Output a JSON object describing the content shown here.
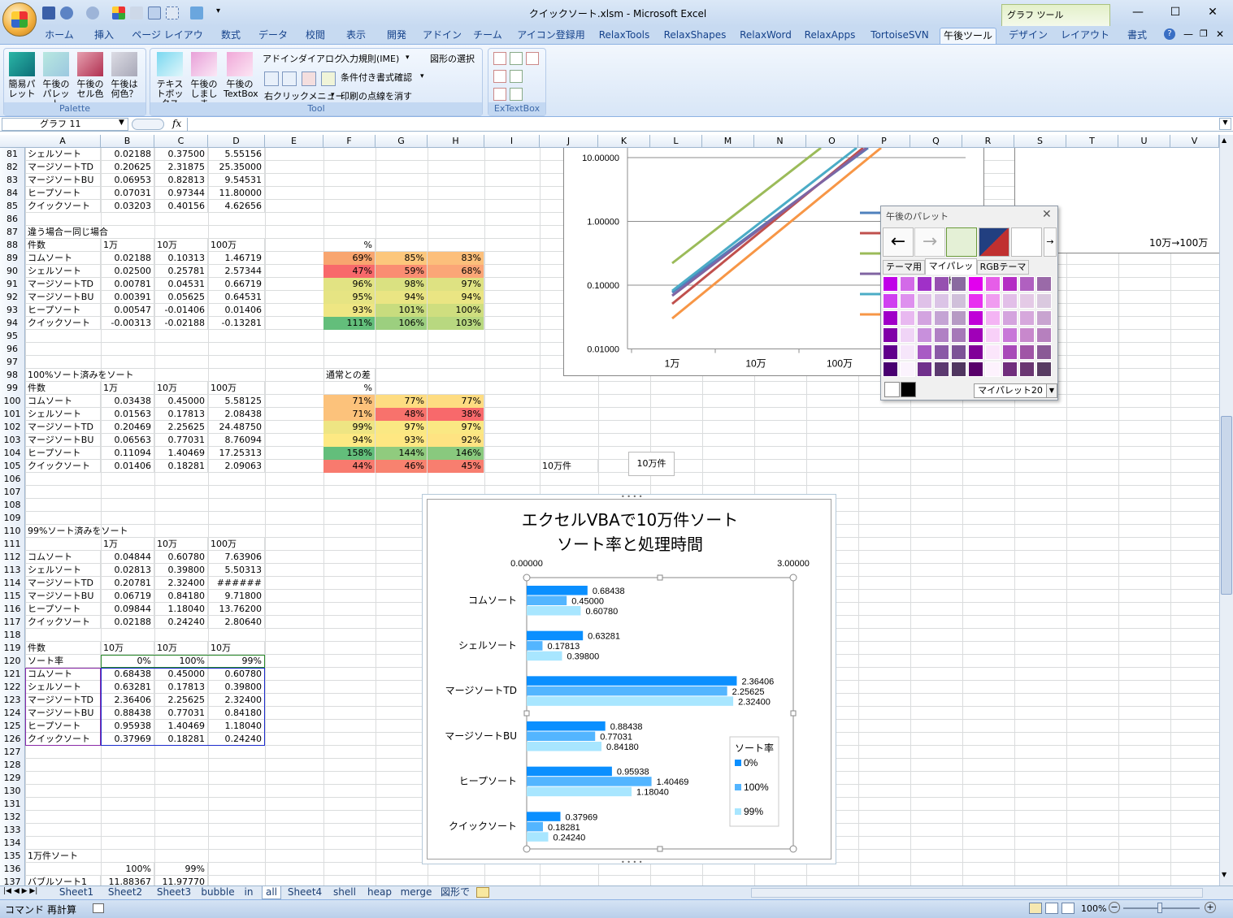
{
  "window": {
    "title": "クイックソート.xlsm - Microsoft Excel",
    "graph_tools": "グラフ ツール",
    "controls": [
      "—",
      "☐",
      "✕"
    ]
  },
  "tabs": [
    "ホーム",
    "挿入",
    "ページ レイアウト",
    "数式",
    "データ",
    "校閲",
    "表示",
    "開発",
    "アドイン",
    "チーム",
    "アイコン登録用",
    "RelaxTools",
    "RelaxShapes",
    "RelaxWord",
    "RelaxApps",
    "TortoiseSVN",
    "午後ツール",
    "デザイン",
    "レイアウト",
    "書式"
  ],
  "active_tab": "午後ツール",
  "ribbon": {
    "palette_group": {
      "label": "Palette",
      "buttons": [
        "簡易パレット",
        "午後のパレット",
        "午後のセル色",
        "午後は何色？"
      ]
    },
    "tool_group": {
      "label": "Tool",
      "big_buttons": [
        "テキストボックス",
        "午後のしましま",
        "午後のTextBox"
      ],
      "small": [
        "アドインダイアログ",
        "入力規則(IME)",
        "図形の選択",
        "条件付き書式確認",
        "右クリックメニュー",
        "印刷の点線を消す"
      ]
    },
    "extextbox_group": {
      "label": "ExTextBox"
    }
  },
  "formula_bar": {
    "name_box": "グラフ 11",
    "fx": "fx",
    "content": ""
  },
  "columns": [
    "A",
    "B",
    "C",
    "D",
    "E",
    "F",
    "G",
    "H",
    "I",
    "J",
    "K",
    "L",
    "M",
    "N",
    "O",
    "P",
    "Q",
    "R",
    "S",
    "T",
    "U",
    "V"
  ],
  "rows": [
    {
      "n": "81",
      "a": "シェルソート",
      "b": "0.02188",
      "c": "0.37500",
      "d": "5.55156"
    },
    {
      "n": "82",
      "a": "マージソートTD",
      "b": "0.20625",
      "c": "2.31875",
      "d": "25.35000"
    },
    {
      "n": "83",
      "a": "マージソートBU",
      "b": "0.06953",
      "c": "0.82813",
      "d": "9.54531"
    },
    {
      "n": "84",
      "a": "ヒープソート",
      "b": "0.07031",
      "c": "0.97344",
      "d": "11.80000"
    },
    {
      "n": "85",
      "a": "クイックソート",
      "b": "0.03203",
      "c": "0.40156",
      "d": "4.62656"
    },
    {
      "n": "86"
    },
    {
      "n": "87",
      "a": "違う場合ー同じ場合"
    },
    {
      "n": "88",
      "a": "件数",
      "b": "1万",
      "c": "10万",
      "d": "100万",
      "f": "%",
      "bl": true
    },
    {
      "n": "89",
      "a": "コムソート",
      "b": "0.02188",
      "c": "0.10313",
      "d": "1.46719",
      "f": "69%",
      "g": "85%",
      "h": "83%"
    },
    {
      "n": "90",
      "a": "シェルソート",
      "b": "0.02500",
      "c": "0.25781",
      "d": "2.57344",
      "f": "47%",
      "g": "59%",
      "h": "68%"
    },
    {
      "n": "91",
      "a": "マージソートTD",
      "b": "0.00781",
      "c": "0.04531",
      "d": "0.66719",
      "f": "96%",
      "g": "98%",
      "h": "97%"
    },
    {
      "n": "92",
      "a": "マージソートBU",
      "b": "0.00391",
      "c": "0.05625",
      "d": "0.64531",
      "f": "95%",
      "g": "94%",
      "h": "94%"
    },
    {
      "n": "93",
      "a": "ヒープソート",
      "b": "0.00547",
      "c": "-0.01406",
      "d": "0.01406",
      "f": "93%",
      "g": "101%",
      "h": "100%"
    },
    {
      "n": "94",
      "a": "クイックソート",
      "b": "-0.00313",
      "c": "-0.02188",
      "d": "-0.13281",
      "f": "111%",
      "g": "106%",
      "h": "103%"
    },
    {
      "n": "95"
    },
    {
      "n": "96"
    },
    {
      "n": "97"
    },
    {
      "n": "98",
      "a": "100%ソート済みをソート",
      "f": "通常との差"
    },
    {
      "n": "99",
      "a": "件数",
      "b": "1万",
      "c": "10万",
      "d": "100万",
      "f": "%",
      "bl": true
    },
    {
      "n": "100",
      "a": "コムソート",
      "b": "0.03438",
      "c": "0.45000",
      "d": "5.58125",
      "f": "71%",
      "g": "77%",
      "h": "77%"
    },
    {
      "n": "101",
      "a": "シェルソート",
      "b": "0.01563",
      "c": "0.17813",
      "d": "2.08438",
      "f": "71%",
      "g": "48%",
      "h": "38%"
    },
    {
      "n": "102",
      "a": "マージソートTD",
      "b": "0.20469",
      "c": "2.25625",
      "d": "24.48750",
      "f": "99%",
      "g": "97%",
      "h": "97%"
    },
    {
      "n": "103",
      "a": "マージソートBU",
      "b": "0.06563",
      "c": "0.77031",
      "d": "8.76094",
      "f": "94%",
      "g": "93%",
      "h": "92%"
    },
    {
      "n": "104",
      "a": "ヒープソート",
      "b": "0.11094",
      "c": "1.40469",
      "d": "17.25313",
      "f": "158%",
      "g": "144%",
      "h": "146%"
    },
    {
      "n": "105",
      "a": "クイックソート",
      "b": "0.01406",
      "c": "0.18281",
      "d": "2.09063",
      "f": "44%",
      "g": "46%",
      "h": "45%",
      "j": "10万件"
    },
    {
      "n": "106"
    },
    {
      "n": "107"
    },
    {
      "n": "108"
    },
    {
      "n": "109"
    },
    {
      "n": "110",
      "a": "99%ソート済みをソート"
    },
    {
      "n": "111",
      "b": "1万",
      "c": "10万",
      "d": "100万",
      "bl": true
    },
    {
      "n": "112",
      "a": "コムソート",
      "b": "0.04844",
      "c": "0.60780",
      "d": "7.63906"
    },
    {
      "n": "113",
      "a": "シェルソート",
      "b": "0.02813",
      "c": "0.39800",
      "d": "5.50313"
    },
    {
      "n": "114",
      "a": "マージソートTD",
      "b": "0.20781",
      "c": "2.32400",
      "d": "######"
    },
    {
      "n": "115",
      "a": "マージソートBU",
      "b": "0.06719",
      "c": "0.84180",
      "d": "9.71800"
    },
    {
      "n": "116",
      "a": "ヒープソート",
      "b": "0.09844",
      "c": "1.18040",
      "d": "13.76200"
    },
    {
      "n": "117",
      "a": "クイックソート",
      "b": "0.02188",
      "c": "0.24240",
      "d": "2.80640"
    },
    {
      "n": "118"
    },
    {
      "n": "119",
      "a": "件数",
      "b": "10万",
      "c": "10万",
      "d": "10万",
      "bl": true
    },
    {
      "n": "120",
      "a": "ソート率",
      "b": "0%",
      "c": "100%",
      "d": "99%"
    },
    {
      "n": "121",
      "a": "コムソート",
      "b": "0.68438",
      "c": "0.45000",
      "d": "0.60780"
    },
    {
      "n": "122",
      "a": "シェルソート",
      "b": "0.63281",
      "c": "0.17813",
      "d": "0.39800"
    },
    {
      "n": "123",
      "a": "マージソートTD",
      "b": "2.36406",
      "c": "2.25625",
      "d": "2.32400"
    },
    {
      "n": "124",
      "a": "マージソートBU",
      "b": "0.88438",
      "c": "0.77031",
      "d": "0.84180"
    },
    {
      "n": "125",
      "a": "ヒープソート",
      "b": "0.95938",
      "c": "1.40469",
      "d": "1.18040"
    },
    {
      "n": "126",
      "a": "クイックソート",
      "b": "0.37969",
      "c": "0.18281",
      "d": "0.24240"
    },
    {
      "n": "127"
    },
    {
      "n": "128"
    },
    {
      "n": "129"
    },
    {
      "n": "130"
    },
    {
      "n": "131"
    },
    {
      "n": "132"
    },
    {
      "n": "133"
    },
    {
      "n": "134"
    },
    {
      "n": "135",
      "a": "1万件ソート"
    },
    {
      "n": "136",
      "b": "100%",
      "c": "99%"
    },
    {
      "n": "137",
      "a": "バブルソート1",
      "b": "11.88367",
      "c": "11.97770"
    }
  ],
  "heat_colors": {
    "89": [
      "#f8a56f",
      "#fcc77c",
      "#fcbf7b"
    ],
    "90": [
      "#f8696b",
      "#fa8d72",
      "#fba677"
    ],
    "91": [
      "#e2e383",
      "#dae181",
      "#dee282"
    ],
    "92": [
      "#e6e483",
      "#eae583",
      "#eae583"
    ],
    "93": [
      "#eee683",
      "#c8dc7e",
      "#cfde7f"
    ],
    "94": [
      "#63be7b",
      "#9ccf7f",
      "#b8d880"
    ]
  },
  "heat_colors2": {
    "100": [
      "#fcc27b",
      "#fedc81",
      "#fedc81"
    ],
    "101": [
      "#fcc27b",
      "#f8726c",
      "#f8696b"
    ],
    "102": [
      "#eee583",
      "#fae883",
      "#fae883"
    ],
    "103": [
      "#fde983",
      "#fee782",
      "#fee382"
    ],
    "104": [
      "#63be7b",
      "#90cb7e",
      "#89c97e"
    ],
    "105": [
      "#f87a6e",
      "#f8826f",
      "#f87e6f"
    ]
  },
  "textbox_label": "10万件",
  "line_chart": {
    "y_ticks": [
      "10.00000",
      "1.00000",
      "0.10000",
      "0.01000"
    ],
    "x_ticks": [
      "1万",
      "10万",
      "100万"
    ],
    "side_label": "10万→100万",
    "series_colors": [
      "#4f81bd",
      "#c0504d",
      "#9bbb59",
      "#8064a2",
      "#4bacc6",
      "#f79646"
    ]
  },
  "chart_data": {
    "type": "bar",
    "title": "エクセルVBAで10万件ソート",
    "subtitle": "ソート率と処理時間",
    "categories": [
      "コムソート",
      "シェルソート",
      "マージソートTD",
      "マージソートBU",
      "ヒープソート",
      "クイックソート"
    ],
    "series": [
      {
        "name": "0%",
        "values": [
          0.68438,
          0.63281,
          2.36406,
          0.88438,
          0.95938,
          0.37969
        ],
        "color": "#0a8fff"
      },
      {
        "name": "100%",
        "values": [
          0.45,
          0.17813,
          2.25625,
          0.77031,
          1.40469,
          0.18281
        ],
        "color": "#53b5ff"
      },
      {
        "name": "99%",
        "values": [
          0.6078,
          0.398,
          2.324,
          0.8418,
          1.1804,
          0.2424
        ],
        "color": "#a8e6ff"
      }
    ],
    "value_labels": [
      [
        "0.68438",
        "0.63281",
        "2.36406",
        "0.88438",
        "0.95938",
        "0.37969"
      ],
      [
        "0.45000",
        "0.17813",
        "2.25625",
        "0.77031",
        "1.40469",
        "0.18281"
      ],
      [
        "0.60780",
        "0.39800",
        "2.32400",
        "0.84180",
        "1.18040",
        "0.24240"
      ]
    ],
    "xlim": [
      0,
      3
    ],
    "x_tick_labels": [
      "0.00000",
      "3.00000"
    ],
    "legend_title": "ソート率",
    "legend": [
      "0%",
      "100%",
      "99%"
    ]
  },
  "palette": {
    "title": "午後のパレット",
    "tabs": [
      "テーマ用",
      "マイパレット",
      "RGBテーマ"
    ],
    "active_tab": "マイパレット",
    "select": "マイパレット20",
    "arrows": [
      "←",
      "→"
    ],
    "colors": [
      [
        "#c000e8",
        "#d36ae8",
        "#a030c8",
        "#9650b0",
        "#8a6aa0",
        "#e200ee",
        "#e65ee8",
        "#b42ec4",
        "#b060c0",
        "#9a6aa8"
      ],
      [
        "#d040f0",
        "#de90ee",
        "#dfc1e8",
        "#dbc4e6",
        "#d0c0da",
        "#e830f0",
        "#f09cf0",
        "#e2bfe8",
        "#e4cae6",
        "#dac9df"
      ],
      [
        "#a000c8",
        "#e8b8f0",
        "#d3a4e0",
        "#c4a4d4",
        "#b69ac4",
        "#c000d8",
        "#f4b4f4",
        "#d4a4de",
        "#d6a8dc",
        "#c8a4d0"
      ],
      [
        "#8000a8",
        "#f0d4f6",
        "#c890dc",
        "#b080c4",
        "#a678b8",
        "#a000b8",
        "#f8d0f8",
        "#c878d8",
        "#c888cc",
        "#b680be"
      ],
      [
        "#60008c",
        "#f6e6fa",
        "#a85ac4",
        "#8a5aa6",
        "#7c5296",
        "#800098",
        "#fbe6fb",
        "#a84ab8",
        "#a055a6",
        "#8a5a96"
      ],
      [
        "#480070",
        "#fbf3fd",
        "#70308c",
        "#5c3a70",
        "#503660",
        "#58006a",
        "#fdf2fd",
        "#702e7c",
        "#6a3672",
        "#583c62"
      ]
    ],
    "bottom_colors": [
      "#ffffff",
      "#000000"
    ]
  },
  "sheet_tabs": [
    "Sheet1",
    "Sheet2",
    "Sheet3",
    "bubble",
    "in",
    "all",
    "Sheet4",
    "shell",
    "heap",
    "merge",
    "図形で"
  ],
  "active_sheet": "all",
  "status": {
    "mode": "コマンド",
    "recalc": "再計算",
    "zoom": "100%"
  }
}
